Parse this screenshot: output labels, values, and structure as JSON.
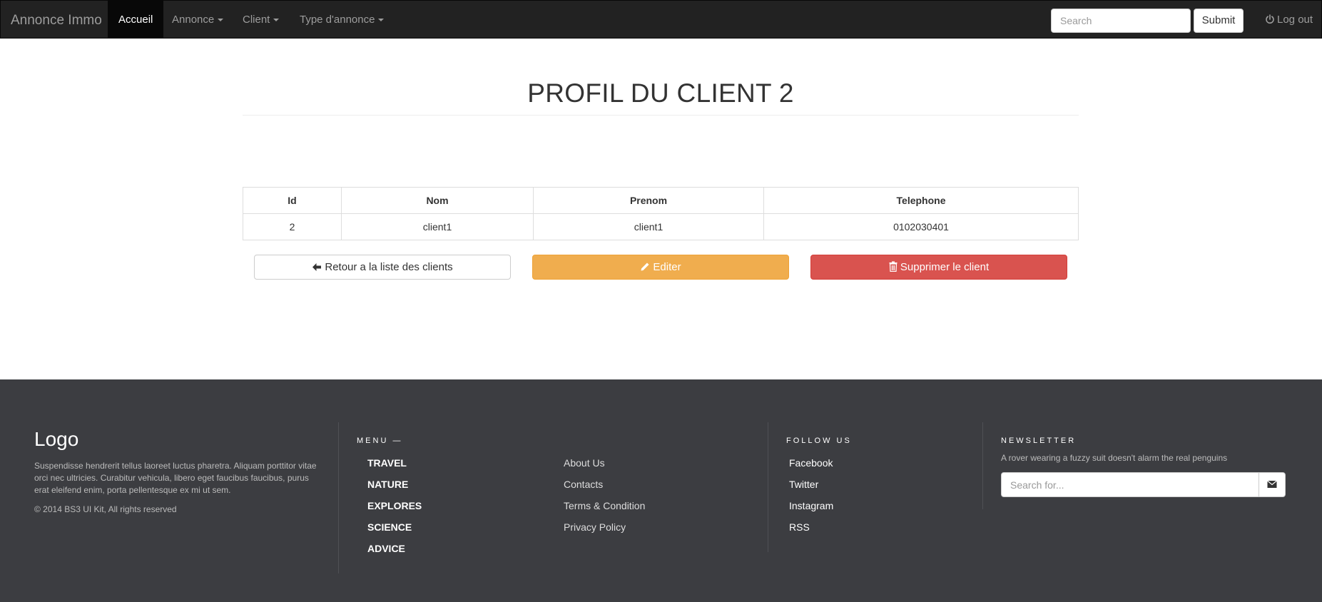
{
  "navbar": {
    "brand": "Annonce Immo",
    "items": [
      {
        "label": "Accueil",
        "active": true
      },
      {
        "label": "Annonce",
        "dropdown": true
      },
      {
        "label": "Client",
        "dropdown": true
      },
      {
        "label": "Type d'annonce",
        "dropdown": true
      }
    ],
    "search_placeholder": "Search",
    "submit_label": "Submit",
    "logout_label": "Log out"
  },
  "page": {
    "title": "PROFIL DU CLIENT 2",
    "table": {
      "headers": [
        "Id",
        "Nom",
        "Prenom",
        "Telephone"
      ],
      "rows": [
        [
          "2",
          "client1",
          "client1",
          "0102030401"
        ]
      ]
    },
    "buttons": {
      "back": "Retour a la liste des clients",
      "edit": "Editer",
      "delete": "Supprimer le client"
    }
  },
  "footer": {
    "logo": "Logo",
    "about": "Suspendisse hendrerit tellus laoreet luctus pharetra. Aliquam porttitor vitae orci nec ultricies. Curabitur vehicula, libero eget faucibus faucibus, purus erat eleifend enim, porta pellentesque ex mi ut sem.",
    "copyright": "© 2014 BS3 UI Kit, All rights reserved",
    "menu_heading": "MENU —",
    "menu_items": [
      "TRAVEL",
      "NATURE",
      "EXPLORES",
      "SCIENCE",
      "ADVICE"
    ],
    "links": [
      "About Us",
      "Contacts",
      "Terms & Condition",
      "Privacy Policy"
    ],
    "follow_heading": "FOLLOW US",
    "social": [
      "Facebook",
      "Twitter",
      "Instagram",
      "RSS"
    ],
    "newsletter_heading": "NEWSLETTER",
    "newsletter_text": "A rover wearing a fuzzy suit doesn't alarm the real penguins",
    "newsletter_placeholder": "Search for..."
  },
  "colors": {
    "navbar_bg": "#222222",
    "footer_bg": "#3c3d41",
    "edit_button": "#f0ad4e",
    "delete_button": "#d9534f"
  }
}
